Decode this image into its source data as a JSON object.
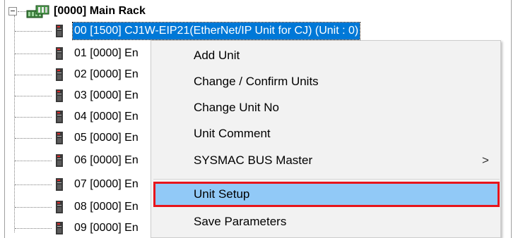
{
  "tree": {
    "root": {
      "label": "[0000] Main Rack",
      "icon": "rack-icon",
      "expanded": true
    },
    "units": [
      {
        "label": "00 [1500] CJ1W-EIP21(EtherNet/IP Unit for CJ) (Unit : 0)",
        "icon": "unit-module-icon",
        "selected": true
      },
      {
        "label": "01 [0000] En",
        "icon": "unit-module-icon",
        "selected": false
      },
      {
        "label": "02 [0000] En",
        "icon": "unit-module-icon",
        "selected": false
      },
      {
        "label": "03 [0000] En",
        "icon": "unit-module-icon",
        "selected": false
      },
      {
        "label": "04 [0000] En",
        "icon": "unit-module-icon",
        "selected": false
      },
      {
        "label": "05 [0000] En",
        "icon": "unit-module-icon",
        "selected": false
      },
      {
        "label": "06 [0000] En",
        "icon": "unit-module-icon",
        "selected": false
      },
      {
        "label": "07 [0000] En",
        "icon": "unit-module-icon",
        "selected": false
      },
      {
        "label": "08 [0000] En",
        "icon": "unit-module-icon",
        "selected": false
      },
      {
        "label": "09 [0000] En",
        "icon": "unit-module-icon",
        "selected": false
      }
    ]
  },
  "context_menu": {
    "items": [
      {
        "label": "Add Unit"
      },
      {
        "label": "Change / Confirm Units"
      },
      {
        "label": "Change Unit No"
      },
      {
        "label": "Unit Comment"
      },
      {
        "label": "SYSMAC BUS Master",
        "submenu_icon": "chevron-right-icon",
        "submenu_glyph": ">"
      },
      {
        "label": "Unit Setup",
        "highlighted": true
      },
      {
        "label": "Save Parameters"
      }
    ]
  },
  "colors": {
    "selection": "#0078d7",
    "menu_background": "#f2f2f2",
    "menu_hover": "#91c9f7",
    "highlight_border": "#e8141b"
  }
}
